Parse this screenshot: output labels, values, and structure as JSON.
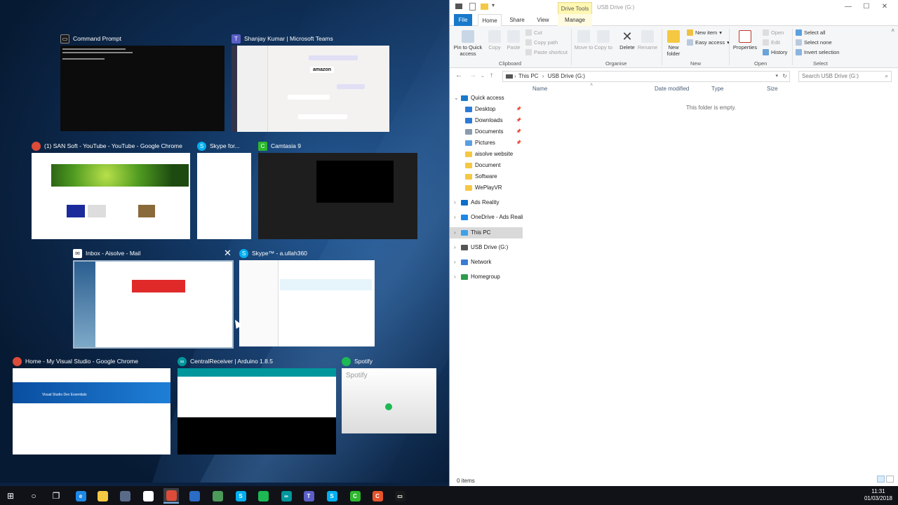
{
  "task_view": {
    "windows": [
      {
        "id": "cmd",
        "title": "Command Prompt",
        "icon": "cmd-icon",
        "color": "#1a1a1a"
      },
      {
        "id": "teams",
        "title": "Shanjay Kumar | Microsoft Teams",
        "icon": "teams-icon",
        "color": "#5b5fc7"
      },
      {
        "id": "chrome-yt",
        "title": "(1) SAN Soft - YouTube - YouTube - Google Chrome",
        "icon": "chrome-icon",
        "color": "#dd4b39"
      },
      {
        "id": "skype-for",
        "title": "Skype for...",
        "icon": "skype-icon",
        "color": "#00aff0"
      },
      {
        "id": "camtasia",
        "title": "Camtasia 9",
        "icon": "camtasia-icon",
        "color": "#2eb82e"
      },
      {
        "id": "mail",
        "title": "Inbox - Aisolve - Mail",
        "icon": "mail-icon",
        "color": "#ffffff"
      },
      {
        "id": "skype-tm",
        "title": "Skype™ - a.ullah360",
        "icon": "skype-icon",
        "color": "#00aff0"
      },
      {
        "id": "chrome-vs",
        "title": "Home - My Visual Studio - Google Chrome",
        "icon": "chrome-icon",
        "color": "#dd4b39"
      },
      {
        "id": "arduino",
        "title": "CentralReceiver | Arduino 1.8.5",
        "icon": "arduino-icon",
        "color": "#00979c"
      },
      {
        "id": "spotify",
        "title": "Spotify",
        "icon": "spotify-icon",
        "color": "#1db954"
      }
    ],
    "thumb_text": {
      "amazon": "amazon",
      "spotify": "Spotify",
      "vs_banner": "Visual Studio Dev Essentials"
    },
    "close_glyph": "✕"
  },
  "explorer": {
    "ribbon_tabs": {
      "file": "File",
      "home": "Home",
      "share": "Share",
      "view": "View",
      "manage": "Manage"
    },
    "contextual_tab": "Drive Tools",
    "window_title": "USB Drive (G:)",
    "ribbon": {
      "pin": "Pin to Quick access",
      "copy": "Copy",
      "paste": "Paste",
      "cut": "Cut",
      "copy_path": "Copy path",
      "paste_shortcut": "Paste shortcut",
      "move_to": "Move to",
      "copy_to": "Copy to",
      "delete": "Delete",
      "rename": "Rename",
      "new_folder": "New folder",
      "new_item": "New item",
      "easy_access": "Easy access",
      "properties": "Properties",
      "open": "Open",
      "edit": "Edit",
      "history": "History",
      "select_all": "Select all",
      "select_none": "Select none",
      "invert_selection": "Invert selection",
      "groups": {
        "clipboard": "Clipboard",
        "organise": "Organise",
        "new": "New",
        "open": "Open",
        "select": "Select"
      }
    },
    "address": {
      "path_parts": [
        "This PC",
        "USB Drive (G:)"
      ],
      "sep": "›",
      "search_placeholder": "Search USB Drive (G:)"
    },
    "nav": [
      {
        "label": "Quick access",
        "color": "#1979ca",
        "indent": 0,
        "pinned": false,
        "expanded": true
      },
      {
        "label": "Desktop",
        "color": "#2b7bd6",
        "indent": 1,
        "pinned": true
      },
      {
        "label": "Downloads",
        "color": "#2b7bd6",
        "indent": 1,
        "pinned": true
      },
      {
        "label": "Documents",
        "color": "#8a9bb0",
        "indent": 1,
        "pinned": true
      },
      {
        "label": "Pictures",
        "color": "#5aa0e0",
        "indent": 1,
        "pinned": true
      },
      {
        "label": "aisolve website",
        "color": "#f5c842",
        "indent": 1,
        "pinned": false
      },
      {
        "label": "Document",
        "color": "#f5c842",
        "indent": 1,
        "pinned": false
      },
      {
        "label": "Software",
        "color": "#f5c842",
        "indent": 1,
        "pinned": false
      },
      {
        "label": "WePlayVR",
        "color": "#f5c842",
        "indent": 1,
        "pinned": false
      },
      {
        "label": "Ads Reality",
        "color": "#0b6ec7",
        "indent": 0,
        "pinned": false
      },
      {
        "label": "OneDrive - Ads Realit",
        "color": "#1e88e5",
        "indent": 0,
        "pinned": false
      },
      {
        "label": "This PC",
        "color": "#3ea0e8",
        "indent": 0,
        "pinned": false,
        "selected": true
      },
      {
        "label": "USB Drive (G:)",
        "color": "#555555",
        "indent": 0,
        "pinned": false
      },
      {
        "label": "Network",
        "color": "#3a7bd5",
        "indent": 0,
        "pinned": false
      },
      {
        "label": "Homegroup",
        "color": "#2e9c4a",
        "indent": 0,
        "pinned": false
      }
    ],
    "columns": {
      "name": "Name",
      "date": "Date modified",
      "type": "Type",
      "size": "Size"
    },
    "empty_message": "This folder is empty.",
    "status": "0 items"
  },
  "taskbar": {
    "items": [
      {
        "name": "start-button",
        "glyph": "⊞",
        "color": "#ffffff"
      },
      {
        "name": "cortana-button",
        "glyph": "○",
        "color": "#ffffff"
      },
      {
        "name": "task-view-button",
        "glyph": "❐",
        "color": "#ffffff"
      },
      {
        "name": "edge-icon",
        "glyph": "e",
        "color": "#1e88e5"
      },
      {
        "name": "file-explorer-icon",
        "glyph": "",
        "color": "#f5c842"
      },
      {
        "name": "store-icon",
        "glyph": "",
        "color": "#5a6b8a"
      },
      {
        "name": "mail-icon",
        "glyph": "✉",
        "color": "#ffffff"
      },
      {
        "name": "chrome-icon",
        "glyph": "",
        "color": "#dd4b39",
        "active": true
      },
      {
        "name": "outlook-icon",
        "glyph": "",
        "color": "#2b6cc4"
      },
      {
        "name": "tool-icon",
        "glyph": "",
        "color": "#4c9a5a"
      },
      {
        "name": "skype-icon",
        "glyph": "S",
        "color": "#00aff0"
      },
      {
        "name": "spotify-icon",
        "glyph": "",
        "color": "#1db954"
      },
      {
        "name": "arduino-icon",
        "glyph": "∞",
        "color": "#00979c"
      },
      {
        "name": "teams-icon",
        "glyph": "T",
        "color": "#5b5fc7"
      },
      {
        "name": "skype-icon-2",
        "glyph": "S",
        "color": "#00aff0"
      },
      {
        "name": "camtasia-icon",
        "glyph": "C",
        "color": "#2eb82e"
      },
      {
        "name": "camtasia-recorder-icon",
        "glyph": "C",
        "color": "#e8542c"
      },
      {
        "name": "cmd-icon",
        "glyph": "▭",
        "color": "#1a1a1a"
      }
    ],
    "clock": {
      "time": "11:31",
      "date": "01/03/2018"
    }
  }
}
